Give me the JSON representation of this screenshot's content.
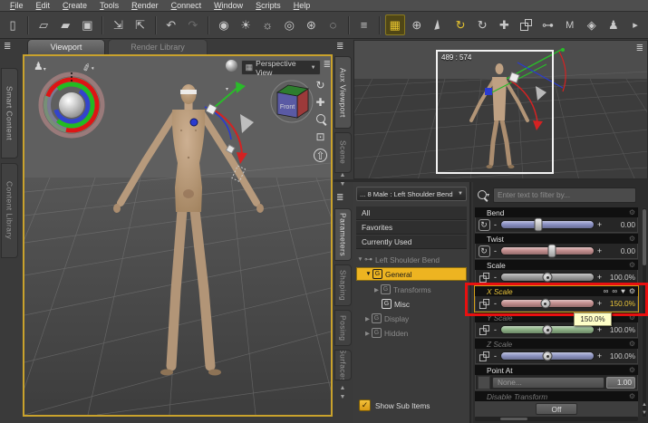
{
  "menu": {
    "items": [
      "File",
      "Edit",
      "Create",
      "Tools",
      "Render",
      "Connect",
      "Window",
      "Scripts",
      "Help"
    ]
  },
  "toolbar": {
    "icons": [
      {
        "name": "new-file",
        "glyph": "▯"
      },
      {
        "name": "open-file",
        "glyph": "▱"
      },
      {
        "name": "open-recent",
        "glyph": "▰"
      },
      {
        "name": "save-file",
        "glyph": "▣"
      },
      {
        "name": "import-file",
        "glyph": "⇲"
      },
      {
        "name": "export-file",
        "glyph": "⇱"
      },
      {
        "name": "undo",
        "glyph": "↶"
      },
      {
        "name": "redo",
        "glyph": "↷"
      },
      {
        "name": "create-camera",
        "glyph": "◉"
      },
      {
        "name": "create-distant-light",
        "glyph": "☀"
      },
      {
        "name": "create-point-light",
        "glyph": "☼"
      },
      {
        "name": "create-linear-point-light",
        "glyph": "◎"
      },
      {
        "name": "create-spotlight",
        "glyph": "⊛"
      },
      {
        "name": "create-null",
        "glyph": "◌"
      },
      {
        "name": "scene-list",
        "glyph": "≡"
      },
      {
        "name": "powerpose",
        "glyph": "▦"
      },
      {
        "name": "aim-at",
        "glyph": "⊕"
      },
      {
        "name": "node-selection-tool",
        "glyph": ""
      },
      {
        "name": "active-pose-tool",
        "glyph": "↻"
      },
      {
        "name": "rotate-tool",
        "glyph": "↻"
      },
      {
        "name": "translate-tool",
        "glyph": "✚"
      },
      {
        "name": "scale-tool",
        "glyph": ""
      },
      {
        "name": "joint-editor-tool",
        "glyph": "⊶"
      },
      {
        "name": "mesh-grabber-tool",
        "glyph": "M"
      },
      {
        "name": "geometry-editor-tool",
        "glyph": "◈"
      },
      {
        "name": "figure-setup-tool",
        "glyph": "♟"
      },
      {
        "name": "toolbar-overflow",
        "glyph": "▸"
      }
    ]
  },
  "left_dock": {
    "tabs": [
      {
        "label": "Smart Content"
      },
      {
        "label": "Content Library"
      }
    ]
  },
  "viewport": {
    "tabs": [
      {
        "label": "Viewport"
      },
      {
        "label": "Render Library"
      }
    ],
    "view_selector": {
      "label": "Perspective View"
    },
    "cube_front_label": "Front",
    "nav": {
      "orbit": "↻",
      "pan": "✚",
      "frame": "⊡",
      "home": "⇧"
    }
  },
  "aux": {
    "tabs": [
      {
        "label": "Aux Viewport"
      },
      {
        "label": "Scene"
      }
    ],
    "frame_label": "489 : 574"
  },
  "params": {
    "tabs": [
      {
        "label": "Parameters"
      },
      {
        "label": "Shaping"
      },
      {
        "label": "Posing"
      },
      {
        "label": "Surfaces"
      }
    ],
    "header": "... 8 Male : Left Shoulder Bend",
    "filter_placeholder": "Enter text to filter by...",
    "list": [
      "All",
      "Favorites",
      "Currently Used"
    ],
    "tree": [
      {
        "arrow": "▼",
        "label": "Left Shoulder Bend"
      },
      {
        "arrow": "▼",
        "label": "General"
      },
      {
        "arrow": "▶",
        "label": "Transforms"
      },
      {
        "arrow": "",
        "label": "Misc"
      },
      {
        "arrow": "▶",
        "label": "Display"
      },
      {
        "arrow": "▶",
        "label": "Hidden"
      }
    ],
    "show_sub_items": "Show Sub Items",
    "sliders": [
      {
        "label": "Bend",
        "value": "0.00",
        "pct": "40%",
        "color": "#8a90c4"
      },
      {
        "label": "Twist",
        "value": "0.00",
        "pct": "55%",
        "color": "#c48f8f"
      },
      {
        "label": "Scale",
        "value": "100.0%",
        "pct": "50%",
        "color": "#9f9f9f"
      },
      {
        "label": "X Scale",
        "value": "150.0%",
        "pct": "48%",
        "color": "#c48f8f"
      },
      {
        "label": "Y Scale",
        "value": "100.0%",
        "pct": "50%",
        "color": "#8fb388"
      },
      {
        "label": "Z Scale",
        "value": "100.0%",
        "pct": "50%",
        "color": "#8f96c4"
      }
    ],
    "point_at": {
      "label": "Point At",
      "button": "None...",
      "value": "1.00"
    },
    "disable_transform": {
      "label": "Disable Transform",
      "button": "Off"
    },
    "tooltip": "150.0%"
  },
  "icons": {
    "gear": "⚙",
    "heart": "♥",
    "link": "∞",
    "unlink": "∞",
    "minus": "-",
    "plus": "+",
    "menu": "≣",
    "dropdown": "▼",
    "small_down": "▾",
    "window": "▦",
    "check": "✓",
    "rotate": "↻",
    "bone": "⊶",
    "pin": "✐",
    "figure": "♟",
    "up": "▲",
    "down": "▼",
    "group": "G",
    "overflow": "▸"
  },
  "colors": {
    "selection_yellow": "#edb421",
    "viewport_border": "#c9a22c",
    "annotation_red": "#e81010",
    "value_yellow": "#e8c33a"
  }
}
